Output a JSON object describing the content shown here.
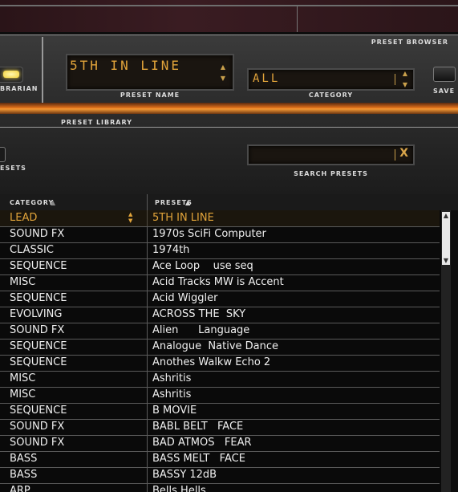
{
  "browser": {
    "section_title": "PRESET BROWSER",
    "librarian_label": "BRARIAN",
    "preset_name_value": "5TH IN LINE",
    "preset_name_label": "PRESET NAME",
    "category_value": "ALL",
    "category_label": "CATEGORY",
    "save_label": "SAVE"
  },
  "library": {
    "section_title": "PRESET LIBRARY",
    "presets_label": "ESETS",
    "search_value": "",
    "search_clear": "X",
    "search_label": "SEARCH PRESETS"
  },
  "table": {
    "col_category": "CATEGORY",
    "col_presets": "PRESETS",
    "sort_arrow": "▲",
    "rows": [
      {
        "category": "LEAD",
        "preset": "5TH IN LINE"
      },
      {
        "category": "SOUND FX",
        "preset": "1970s SciFi Computer"
      },
      {
        "category": "CLASSIC",
        "preset": "1974th"
      },
      {
        "category": "SEQUENCE",
        "preset": "Ace Loop    use seq"
      },
      {
        "category": "MISC",
        "preset": "Acid Tracks MW is Accent"
      },
      {
        "category": "SEQUENCE",
        "preset": "Acid Wiggler"
      },
      {
        "category": "EVOLVING",
        "preset": "ACROSS THE  SKY"
      },
      {
        "category": "SOUND FX",
        "preset": "Alien      Language"
      },
      {
        "category": "SEQUENCE",
        "preset": "Analogue  Native Dance"
      },
      {
        "category": "SEQUENCE",
        "preset": "Anothes Walkw Echo 2"
      },
      {
        "category": "MISC",
        "preset": "Ashritis"
      },
      {
        "category": "MISC",
        "preset": "Ashritis"
      },
      {
        "category": "SEQUENCE",
        "preset": "B MOVIE"
      },
      {
        "category": "SOUND FX",
        "preset": "BABL BELT   FACE"
      },
      {
        "category": "SOUND FX",
        "preset": "BAD ATMOS   FEAR"
      },
      {
        "category": "BASS",
        "preset": "BASS MELT   FACE"
      },
      {
        "category": "BASS",
        "preset": "BASSY 12dB"
      },
      {
        "category": "ARP",
        "preset": "Bells Hells"
      }
    ]
  },
  "colors": {
    "lcd_text": "#e2a43a",
    "selected_text": "#e2a43a",
    "accent_orange": "#f59a35"
  }
}
